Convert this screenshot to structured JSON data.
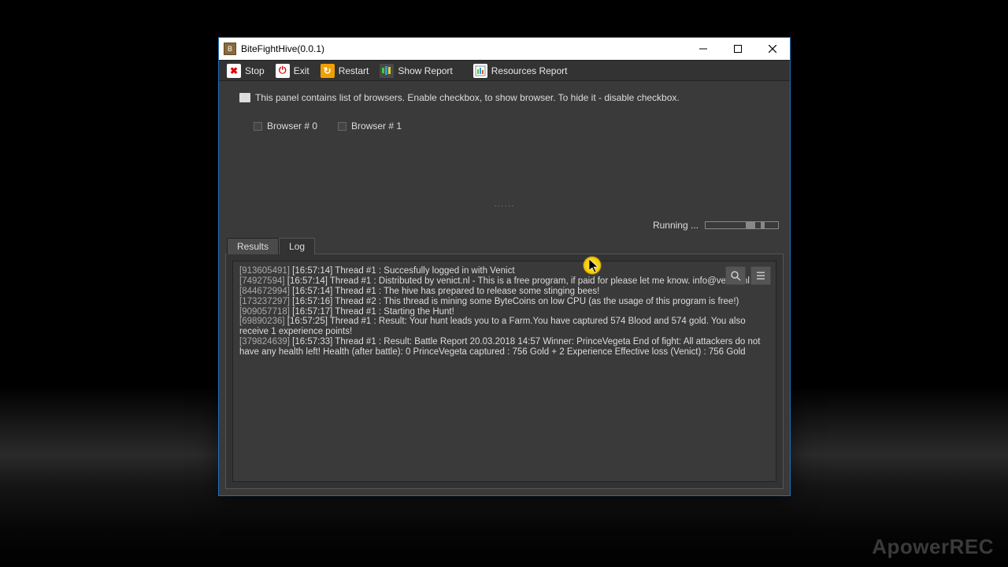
{
  "window": {
    "title": "BiteFightHive(0.0.1)"
  },
  "toolbar": {
    "stop": "Stop",
    "exit": "Exit",
    "restart": "Restart",
    "show_report": "Show Report",
    "resources_report": "Resources Report"
  },
  "panel": {
    "info": "This panel contains list of browsers. Enable checkbox, to show browser. To hide it - disable checkbox.",
    "browsers": [
      "Browser # 0",
      "Browser # 1"
    ],
    "status": "Running ..."
  },
  "tabs": {
    "results": "Results",
    "log": "Log",
    "active": "Log"
  },
  "log": [
    {
      "code": "[913605491]",
      "text": "[16:57:14] Thread #1 : Succesfully logged in with Venict"
    },
    {
      "code": "[74927594]",
      "text": "[16:57:14] Thread #1 : Distributed by venict.nl - This is a free program, if paid for please let me know. info@venict.nl"
    },
    {
      "code": "[844672994]",
      "text": "[16:57:14] Thread #1 : The hive has prepared to release some stinging bees!"
    },
    {
      "code": "[173237297]",
      "text": "[16:57:16] Thread #2 : This thread is mining some ByteCoins on low CPU (as the usage of this program is free!)"
    },
    {
      "code": "[909057718]",
      "text": "[16:57:17] Thread #1 : Starting the Hunt!"
    },
    {
      "code": "[69890236]",
      "text": "[16:57:25] Thread #1 : Result: Your hunt leads you to a Farm.You have captured 574 Blood and 574 gold. You also receive 1 experience points!"
    },
    {
      "code": "[379824639]",
      "text": "[16:57:33] Thread #1 : Result: Battle Report 20.03.2018 14:57 Winner: PrinceVegeta End of fight: All attackers do not have any health left! Health (after battle): 0 PrinceVegeta captured : 756 Gold + 2 Experience Effective loss (Venict) : 756 Gold"
    }
  ],
  "watermark": "ApowerREC"
}
